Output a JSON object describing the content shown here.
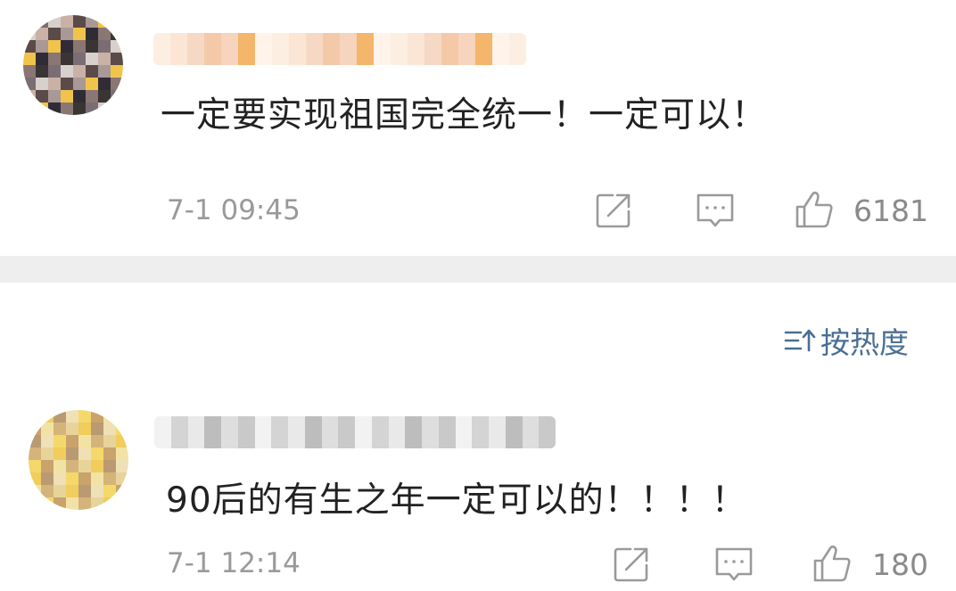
{
  "comments": [
    {
      "text": "一定要实现祖国完全统一！一定可以！",
      "time": "7-1 09:45",
      "likes": "6181"
    },
    {
      "text": "90后的有生之年一定可以的！！！！",
      "time": "7-1 12:14",
      "likes": "180"
    }
  ],
  "sort": {
    "label": "按热度"
  },
  "icons": {
    "share": "share-icon",
    "comment": "comment-icon",
    "like": "thumbs-up-icon",
    "sort": "sort-icon"
  },
  "colors": {
    "text": "#222222",
    "meta": "#9a9a9a",
    "accent": "#4a6f93",
    "divider": "#eeeeee"
  }
}
